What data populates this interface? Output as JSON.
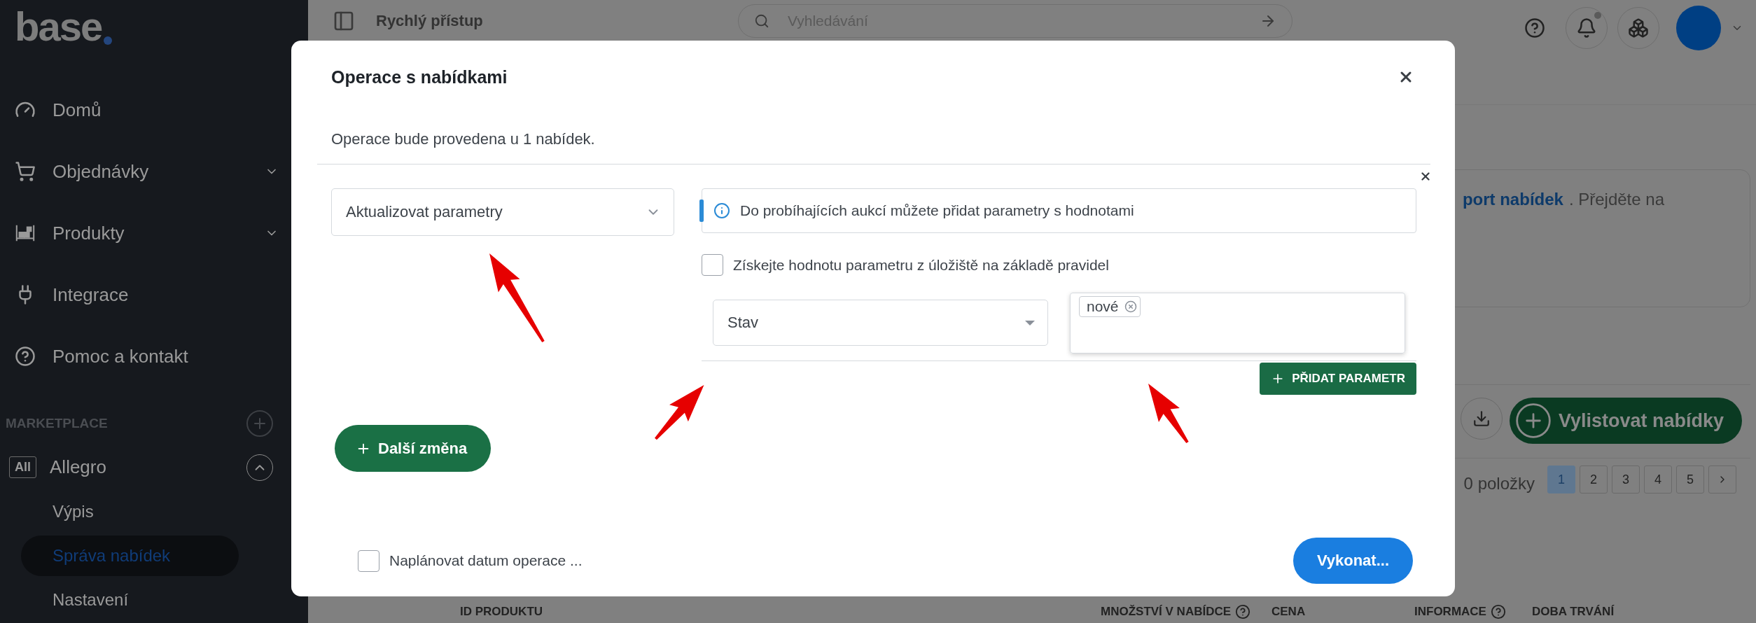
{
  "sidebar": {
    "logo": "base",
    "items": [
      {
        "label": "Domů"
      },
      {
        "label": "Objednávky",
        "expanded": false
      },
      {
        "label": "Produkty",
        "expanded": false
      },
      {
        "label": "Integrace"
      },
      {
        "label": "Pomoc a kontakt"
      }
    ],
    "marketplace": {
      "heading": "MARKETPLACE",
      "channels": [
        {
          "badge": "All",
          "name": "Allegro",
          "expanded": true,
          "children": [
            {
              "label": "Výpis",
              "selected": false
            },
            {
              "label": "Správa nabídek",
              "selected": true
            },
            {
              "label": "Nastavení",
              "selected": false
            }
          ]
        }
      ]
    }
  },
  "topbar": {
    "quick_access": "Rychlý přístup",
    "search": {
      "placeholder": "Vyhledávání"
    },
    "notifications_unread": true
  },
  "page": {
    "notice": {
      "link": "port nabídek",
      "text": ". Přejděte na"
    },
    "list_button": "Vylistovat nabídky",
    "count": "0 položky",
    "pages": [
      {
        "label": "1",
        "selected": true
      },
      {
        "label": "2",
        "selected": false
      },
      {
        "label": "3",
        "selected": false
      },
      {
        "label": "4",
        "selected": false
      },
      {
        "label": "5",
        "selected": false
      }
    ],
    "table_columns": [
      {
        "label": "ID PRODUKTU",
        "help": false
      },
      {
        "label": "MNOŽSTVÍ V NABÍDCE",
        "help": true
      },
      {
        "label": "CENA",
        "help": false
      },
      {
        "label": "INFORMACE",
        "help": true
      },
      {
        "label": "DOBA TRVÁNÍ",
        "help": false
      }
    ]
  },
  "modal": {
    "title": "Operace s nabídkami",
    "description": "Operace bude provedena u 1 nabídek.",
    "operation": {
      "value": "Aktualizovat parametry"
    },
    "info": "Do probíhajících aukcí můžete přidat parametry s hodnotami",
    "from_storage": {
      "label": "Získejte hodnotu parametru z úložiště na základě pravidel",
      "checked": false
    },
    "parameters": [
      {
        "name": "Stav",
        "values": [
          {
            "label": "nové"
          }
        ]
      }
    ],
    "add_parameter": "PŘIDAT PARAMETR",
    "another_change": "Další změna",
    "schedule": {
      "label": "Naplánovat datum operace ...",
      "checked": false
    },
    "submit": "Vykonat..."
  }
}
